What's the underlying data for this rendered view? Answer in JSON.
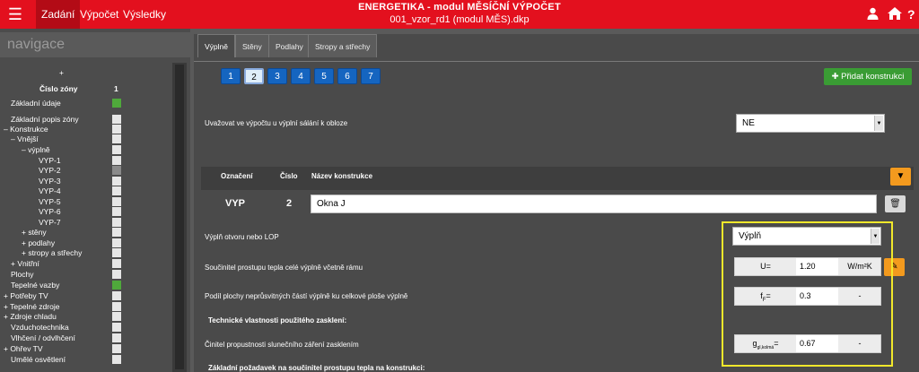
{
  "topbar": {
    "menu_icon": "hamburger-icon",
    "tabs": [
      "Zadání",
      "Výpočet",
      "Výsledky"
    ],
    "title": "ENERGETIKA - modul MĚSÍČNÍ VÝPOČET",
    "subtitle": "001_vzor_rd1 (modul MĚS).dkp",
    "user_icon": "user-icon",
    "home_icon": "home-icon",
    "help_icon": "question-icon"
  },
  "sidebar": {
    "title": "navigace",
    "plus": "+",
    "zone_label": "Číslo zóny",
    "zone_value": "1",
    "items": [
      {
        "label": "Základní údaje",
        "box": "green"
      },
      {
        "label": "Základní popis zóny",
        "box": "white"
      },
      {
        "label": "–  Konstrukce",
        "box": "white"
      },
      {
        "label": "–  Vnější",
        "box": "white"
      },
      {
        "label": "–  výplně",
        "box": "white"
      },
      {
        "label": "VYP-1",
        "box": "white"
      },
      {
        "label": "VYP-2",
        "box": "grey"
      },
      {
        "label": "VYP-3",
        "box": "white"
      },
      {
        "label": "VYP-4",
        "box": "white"
      },
      {
        "label": "VYP-5",
        "box": "white"
      },
      {
        "label": "VYP-6",
        "box": "white"
      },
      {
        "label": "VYP-7",
        "box": "white"
      },
      {
        "label": "+  stěny",
        "box": "white"
      },
      {
        "label": "+  podlahy",
        "box": "white"
      },
      {
        "label": "+  stropy a střechy",
        "box": "white"
      },
      {
        "label": "+  Vnitřní",
        "box": "white"
      },
      {
        "label": "Plochy",
        "box": "white"
      },
      {
        "label": "Tepelné vazby",
        "box": "green"
      },
      {
        "label": "+  Potřeby TV",
        "box": "white"
      },
      {
        "label": "+  Tepelné zdroje",
        "box": "white"
      },
      {
        "label": "+  Zdroje chladu",
        "box": "white"
      },
      {
        "label": "Vzduchotechnika",
        "box": "white"
      },
      {
        "label": "Vlhčení / odvlhčení",
        "box": "white"
      },
      {
        "label": "+  Ohřev TV",
        "box": "white"
      },
      {
        "label": "Umělé osvětlení",
        "box": "white"
      }
    ]
  },
  "content": {
    "tabs": [
      "Výplně",
      "Stěny",
      "Podlahy",
      "Stropy a střechy"
    ],
    "numbers": [
      "1",
      "2",
      "3",
      "4",
      "5",
      "6",
      "7"
    ],
    "active_number": "2",
    "add_button": "✚ Přidat konstrukci",
    "radiation_label": "Uvažovat ve výpočtu u výplní sálání k obloze",
    "radiation_value": "NE",
    "header": {
      "col1": "Označení",
      "col2": "Číslo",
      "col3": "Název konstrukce"
    },
    "row": {
      "code": "VYP",
      "number": "2",
      "name": "Okna J"
    },
    "opening_label": "Výplň otvoru nebo LOP",
    "opening_value": "Výplň",
    "u_label": "Součinitel prostupu tepla celé výplně včetně rámu",
    "u_symbol": "U=",
    "u_value": "1.20",
    "u_unit": "W/m²K",
    "ff_label": "Podíl plochy neprůsvitných částí výplně ku celkové ploše výplně",
    "ff_symbol": "f",
    "ff_sub": "F",
    "ff_eq": "=",
    "ff_value": "0.3",
    "ff_unit": "-",
    "glazing_heading": "Technické vlastnosti použitého zasklení:",
    "g_label": "Činitel propustnosti slunečního záření zasklením",
    "g_symbol": "g",
    "g_sub": "gl,kolmá",
    "g_eq": "=",
    "g_value": "0.67",
    "g_unit": "-",
    "requirements_heading": "Základní požadavek na součinitel prostupu tepla na konstrukci:"
  },
  "colors": {
    "topbar": "#e3101e",
    "highlight": "#f2e82b",
    "add_button": "#3a9c34",
    "number_button": "#1565c0",
    "orange": "#f39a1e"
  }
}
